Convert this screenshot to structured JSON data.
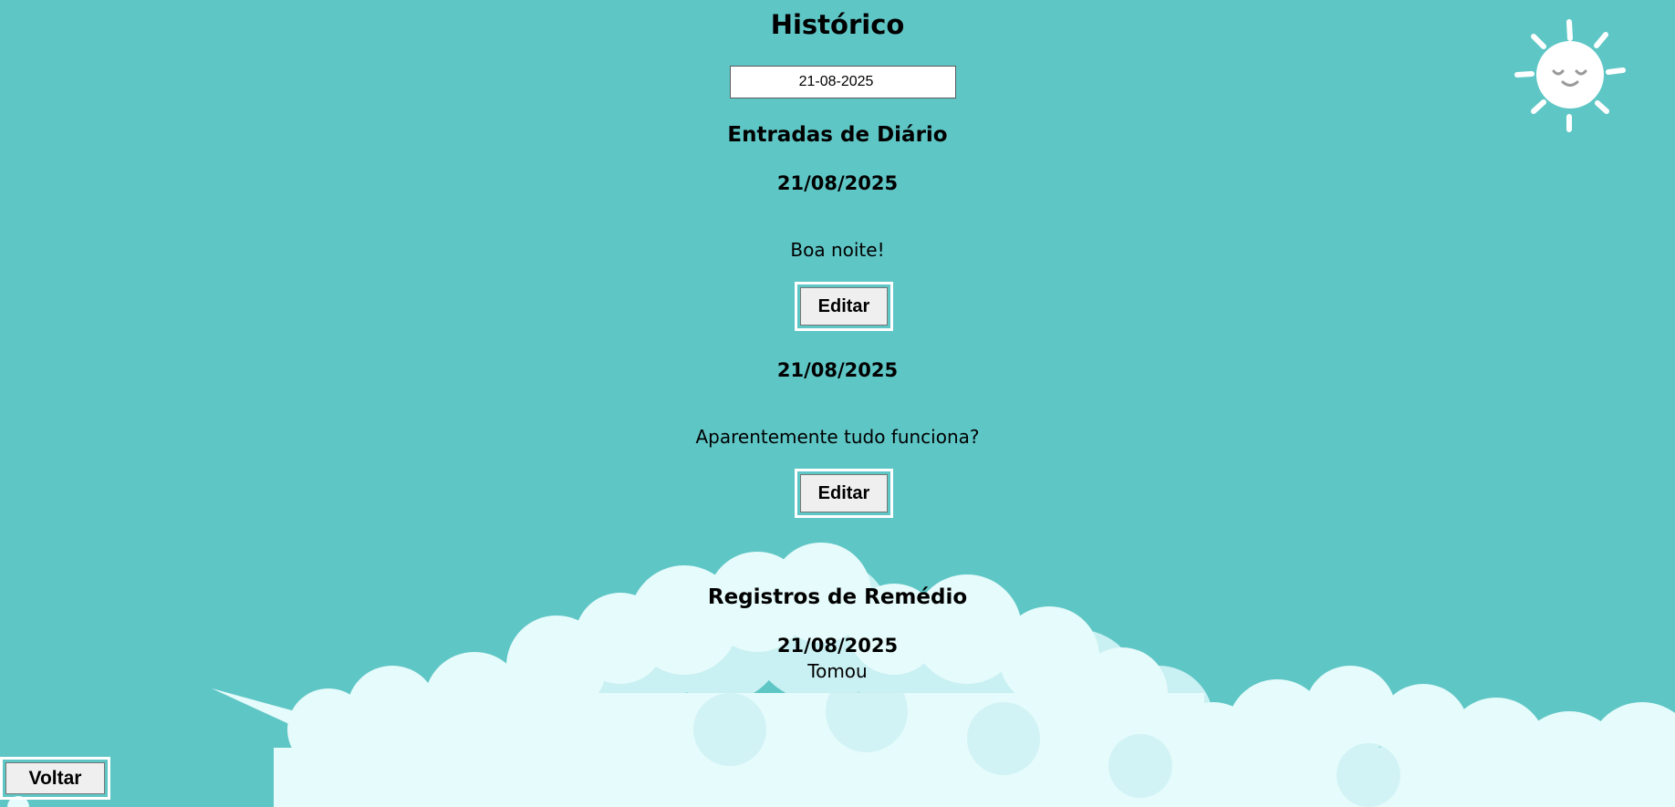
{
  "page": {
    "title": "Histórico"
  },
  "date_picker": {
    "value": "21-08-2025",
    "icon": "calendar-icon"
  },
  "diary": {
    "section_title": "Entradas de Diário",
    "entries": [
      {
        "date": "21/08/2025",
        "text": "Boa noite!",
        "edit_label": "Editar"
      },
      {
        "date": "21/08/2025",
        "text": "Aparentemente tudo funciona?",
        "edit_label": "Editar"
      }
    ]
  },
  "medicine": {
    "section_title": "Registros de Remédio",
    "records": [
      {
        "date": "21/08/2025",
        "status": "Tomou"
      }
    ]
  },
  "footer": {
    "back_label": "Voltar"
  },
  "decor": {
    "sun_icon": "sleeping-sun-icon",
    "colors": {
      "background": "#5fc6c6",
      "cloud_light": "#e6fbfb",
      "cloud_mid": "#c9f0f2",
      "button_border": "#ffffff"
    }
  }
}
